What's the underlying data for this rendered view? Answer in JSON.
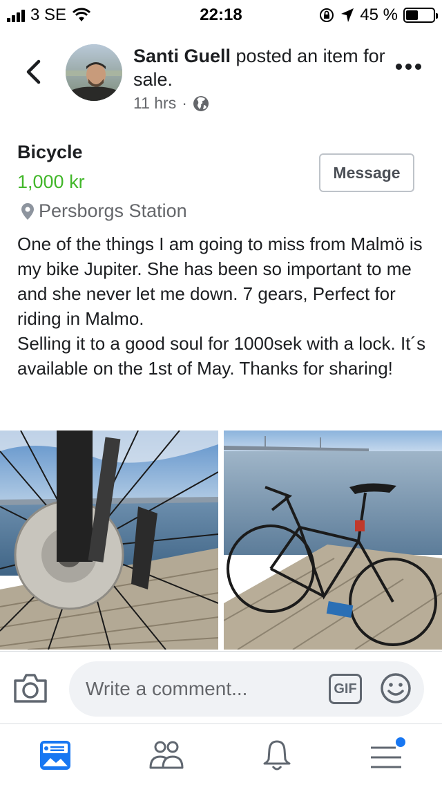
{
  "status_bar": {
    "carrier": "3 SE",
    "time": "22:18",
    "battery": "45 %",
    "battery_level": 0.45,
    "icons": [
      "signal-icon",
      "wifi-icon",
      "rotation-lock-icon",
      "location-arrow-icon",
      "battery-icon"
    ]
  },
  "post": {
    "author": "Santi Guell",
    "action": " posted an item for sale.",
    "time": "11 hrs",
    "separator": "·",
    "privacy_icon": "globe-icon"
  },
  "listing": {
    "title": "Bicycle",
    "price": "1,000 kr",
    "location": "Persborgs Station",
    "message_button": "Message",
    "description": "One of the things I am going  to miss from Malmö is my bike Jupiter. She has been so important to me and she never let me down. 7 gears, Perfect for riding in Malmo.\nSelling it to a good soul for 1000sek with a lock. It´s available on the 1st of May. Thanks for sharing!"
  },
  "comment": {
    "placeholder": "Write a comment...",
    "gif_label": "GIF"
  },
  "tab_bar": {
    "tabs": [
      "marketplace-icon",
      "groups-icon",
      "notifications-icon",
      "menu-icon"
    ],
    "active": "marketplace-icon"
  },
  "colors": {
    "price_green": "#42b72a",
    "brand_blue": "#1877f2",
    "muted_text": "#65676b"
  }
}
